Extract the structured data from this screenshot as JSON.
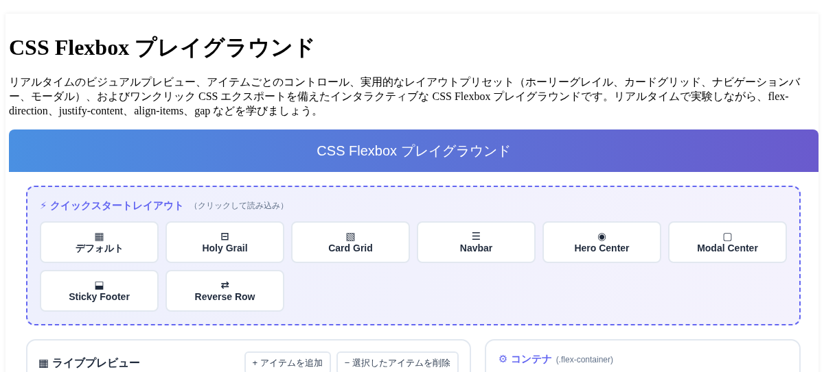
{
  "page": {
    "title": "CSS Flexbox プレイグラウンド",
    "description": "リアルタイムのビジュアルプレビュー、アイテムごとのコントロール、実用的なレイアウトプリセット（ホーリーグレイル、カードグリッド、ナビゲーションバー、モーダル）、およびワンクリック CSS エクスポートを備えたインタラクティブな CSS Flexbox プレイグラウンドです。リアルタイムで実験しながら、flex-direction、justify-content、align-items、gap などを学びましょう。"
  },
  "app_header": {
    "title": "CSS Flexbox プレイグラウンド"
  },
  "quick_start": {
    "icon": "⚡",
    "title": "クイックスタートレイアウト",
    "hint": "（クリックして読み込み）",
    "presets": [
      {
        "icon": "▦",
        "label": "デフォルト"
      },
      {
        "icon": "⊟",
        "label": "Holy Grail"
      },
      {
        "icon": "▧",
        "label": "Card Grid"
      },
      {
        "icon": "☰",
        "label": "Navbar"
      },
      {
        "icon": "◉",
        "label": "Hero Center"
      },
      {
        "icon": "▢",
        "label": "Modal Center"
      },
      {
        "icon": "⬓",
        "label": "Sticky Footer"
      },
      {
        "icon": "⇄",
        "label": "Reverse Row"
      }
    ]
  },
  "preview_panel": {
    "icon": "▦",
    "title": "ライブプレビュー",
    "buttons": [
      {
        "label": "+ アイテムを追加"
      },
      {
        "label": "− 選択したアイテムを削除"
      }
    ]
  },
  "container_panel": {
    "icon": "⚙",
    "title": "コンテナ",
    "subtitle": "(.flex-container)"
  }
}
